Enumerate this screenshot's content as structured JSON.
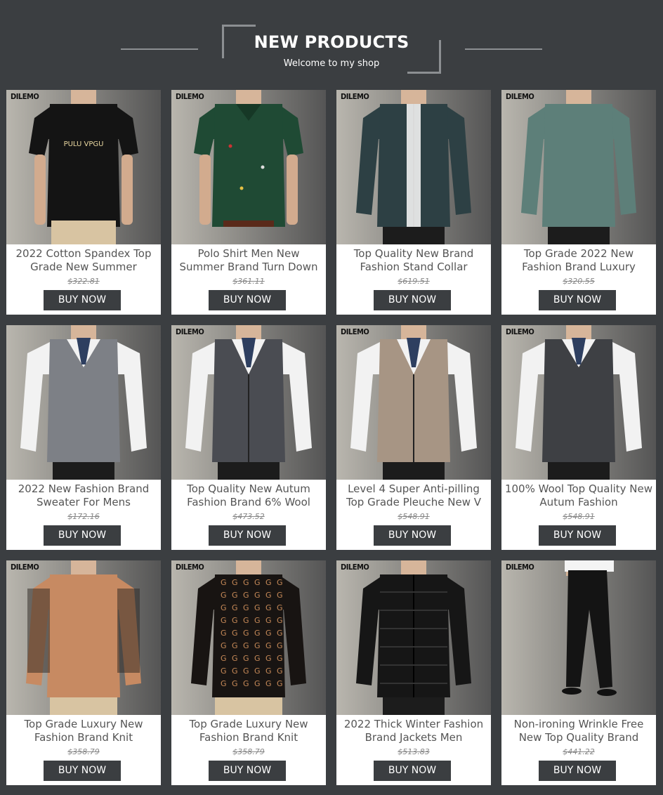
{
  "header": {
    "title": "NEW PRODUCTS",
    "subtitle": "Welcome to my shop"
  },
  "products": [
    {
      "brand": "DILEMO",
      "name": "2022 Cotton Spandex Top Grade New Summer",
      "price": "$322.81",
      "buy": "BUY NOW",
      "garment": "tshirt",
      "color": "#141414",
      "bg": "#b9b6ae"
    },
    {
      "brand": "DILEMO",
      "name": "Polo Shirt Men New Summer Brand Turn Down",
      "price": "$361.11",
      "buy": "BUY NOW",
      "garment": "polo",
      "color": "#1f4a34",
      "bg": "#8e8c88"
    },
    {
      "brand": "DILEMO",
      "name": "Top Quality New Brand Fashion Stand Collar",
      "price": "$619.51",
      "buy": "BUY NOW",
      "garment": "jacket",
      "color": "#2d4044",
      "bg": "#9a9c9c"
    },
    {
      "brand": "DILEMO",
      "name": "Top Grade 2022 New Fashion Brand Luxury",
      "price": "$320.55",
      "buy": "BUY NOW",
      "garment": "longsleeve",
      "color": "#5d7f79",
      "bg": "#8a8a8a"
    },
    {
      "brand": "",
      "name": "2022 New Fashion Brand Sweater For Mens",
      "price": "$172.16",
      "buy": "BUY NOW",
      "garment": "vest",
      "color": "#7d8086",
      "bg": "#d0d0d2"
    },
    {
      "brand": "DILEMO",
      "name": "Top Quality New Autum Fashion Brand 6% Wool",
      "price": "$473.52",
      "buy": "BUY NOW",
      "garment": "cardigan",
      "color": "#4a4c52",
      "bg": "#8e8f90"
    },
    {
      "brand": "DILEMO",
      "name": "Level 4 Super Anti-pilling Top Grade Pleuche New V",
      "price": "$548.91",
      "buy": "BUY NOW",
      "garment": "cardigan",
      "color": "#a79584",
      "bg": "#7d7f80"
    },
    {
      "brand": "DILEMO",
      "name": "100% Wool Top Quality New Autum Fashion",
      "price": "$548.91",
      "buy": "BUY NOW",
      "garment": "vest",
      "color": "#3e4044",
      "bg": "#8e8f90"
    },
    {
      "brand": "DILEMO",
      "name": "Top Grade Luxury New Fashion Brand Knit",
      "price": "$358.79",
      "buy": "BUY NOW",
      "garment": "knit-orange",
      "color": "#c78a62",
      "bg": "#7d7d7d"
    },
    {
      "brand": "DILEMO",
      "name": "Top Grade Luxury New Fashion Brand Knit",
      "price": "$358.79",
      "buy": "BUY NOW",
      "garment": "knit-pattern",
      "color": "#181412",
      "bg": "#5f6163"
    },
    {
      "brand": "DILEMO",
      "name": "2022 Thick Winter Fashion Brand Jackets Men",
      "price": "$513.83",
      "buy": "BUY NOW",
      "garment": "puffer",
      "color": "#161616",
      "bg": "#b3b4b7"
    },
    {
      "brand": "DILEMO",
      "name": "Non-ironing Wrinkle Free New Top Quality Brand",
      "price": "$441.22",
      "buy": "BUY NOW",
      "garment": "pants",
      "color": "#141414",
      "bg": "#cdd0d3"
    }
  ]
}
